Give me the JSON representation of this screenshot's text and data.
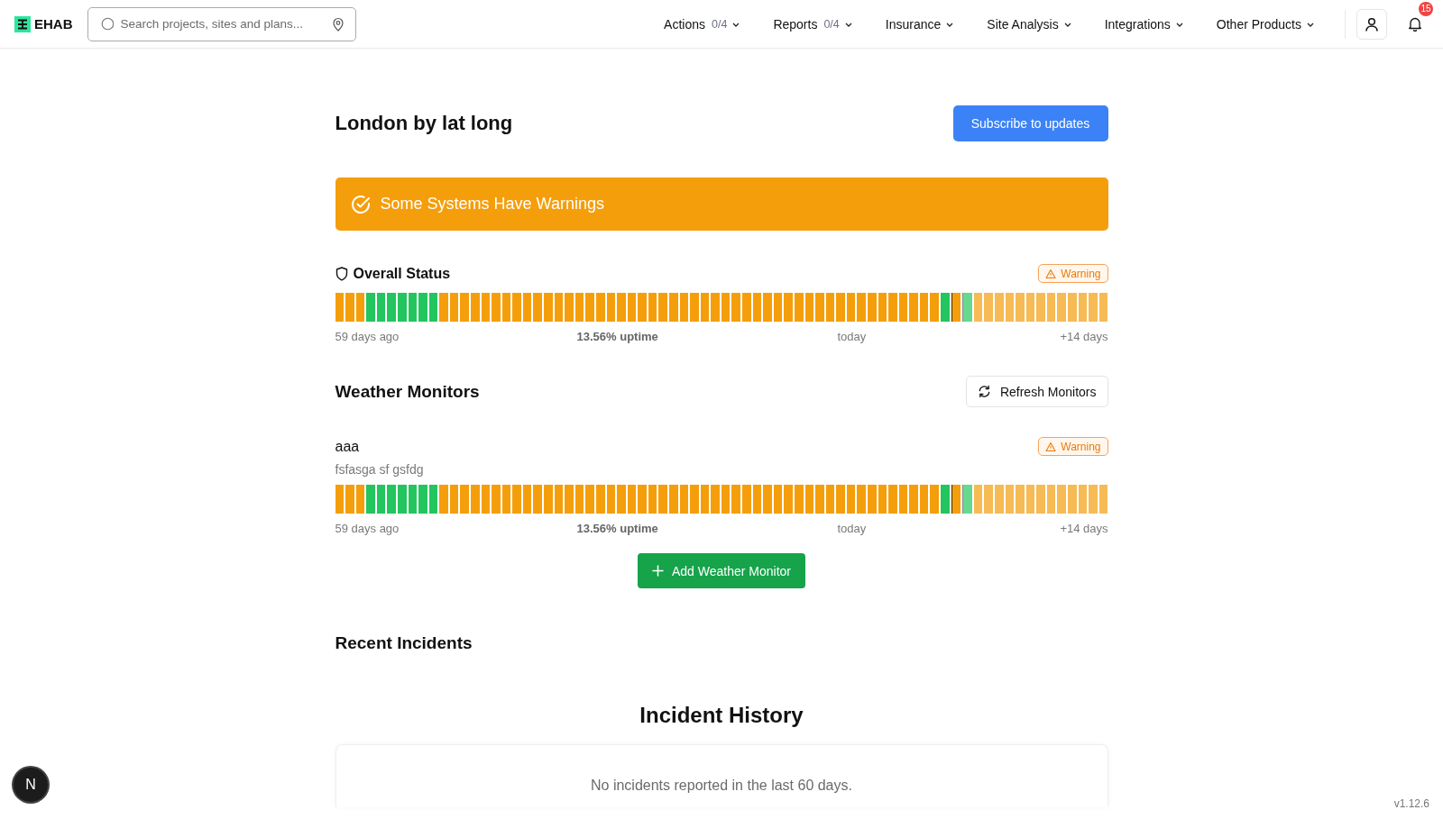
{
  "header": {
    "logo": "EHAB",
    "search": {
      "placeholder": "Search projects, sites and plans..."
    },
    "nav": [
      {
        "label": "Actions",
        "count": "0/4"
      },
      {
        "label": "Reports",
        "count": "0/4"
      },
      {
        "label": "Insurance"
      },
      {
        "label": "Site Analysis"
      },
      {
        "label": "Integrations"
      },
      {
        "label": "Other Products"
      }
    ],
    "notifications": {
      "badge": "15"
    }
  },
  "page": {
    "title": "London by lat long",
    "subscribe_button": "Subscribe to updates",
    "banner": {
      "kind": "warning",
      "text": "Some Systems Have Warnings"
    },
    "overall": {
      "title": "Overall Status",
      "badge": {
        "kind": "warning",
        "text": "Warning"
      },
      "bars": [
        {
          "kind": "warning"
        },
        {
          "kind": "warning"
        },
        {
          "kind": "warning"
        },
        {
          "kind": "operational"
        },
        {
          "kind": "operational"
        },
        {
          "kind": "operational"
        },
        {
          "kind": "operational"
        },
        {
          "kind": "operational"
        },
        {
          "kind": "operational"
        },
        {
          "kind": "operational"
        },
        {
          "kind": "warning"
        },
        {
          "kind": "warning"
        },
        {
          "kind": "warning"
        },
        {
          "kind": "warning"
        },
        {
          "kind": "warning"
        },
        {
          "kind": "warning"
        },
        {
          "kind": "warning"
        },
        {
          "kind": "warning"
        },
        {
          "kind": "warning"
        },
        {
          "kind": "warning"
        },
        {
          "kind": "warning"
        },
        {
          "kind": "warning"
        },
        {
          "kind": "warning"
        },
        {
          "kind": "warning"
        },
        {
          "kind": "warning"
        },
        {
          "kind": "warning"
        },
        {
          "kind": "warning"
        },
        {
          "kind": "warning"
        },
        {
          "kind": "warning"
        },
        {
          "kind": "warning"
        },
        {
          "kind": "warning"
        },
        {
          "kind": "warning"
        },
        {
          "kind": "warning"
        },
        {
          "kind": "warning"
        },
        {
          "kind": "warning"
        },
        {
          "kind": "warning"
        },
        {
          "kind": "warning"
        },
        {
          "kind": "warning"
        },
        {
          "kind": "warning"
        },
        {
          "kind": "warning"
        },
        {
          "kind": "warning"
        },
        {
          "kind": "warning"
        },
        {
          "kind": "warning"
        },
        {
          "kind": "warning"
        },
        {
          "kind": "warning"
        },
        {
          "kind": "warning"
        },
        {
          "kind": "warning"
        },
        {
          "kind": "warning"
        },
        {
          "kind": "warning"
        },
        {
          "kind": "warning"
        },
        {
          "kind": "warning"
        },
        {
          "kind": "warning"
        },
        {
          "kind": "warning"
        },
        {
          "kind": "warning"
        },
        {
          "kind": "warning"
        },
        {
          "kind": "warning"
        },
        {
          "kind": "warning"
        },
        {
          "kind": "warning"
        },
        {
          "kind": "operational"
        },
        {
          "kind": "today-warning"
        },
        {
          "kind": "forecast-operational"
        },
        {
          "kind": "forecast-warning"
        },
        {
          "kind": "forecast-warning"
        },
        {
          "kind": "forecast-warning"
        },
        {
          "kind": "forecast-warning"
        },
        {
          "kind": "forecast-warning"
        },
        {
          "kind": "forecast-warning"
        },
        {
          "kind": "forecast-warning"
        },
        {
          "kind": "forecast-warning"
        },
        {
          "kind": "forecast-warning"
        },
        {
          "kind": "forecast-warning"
        },
        {
          "kind": "forecast-warning"
        },
        {
          "kind": "forecast-warning"
        },
        {
          "kind": "forecast-warning"
        }
      ],
      "labels": {
        "start": "59 days ago",
        "uptime": "13.56% uptime",
        "today": "today",
        "end": "+14 days"
      }
    },
    "monitors_section": {
      "title": "Weather Monitors",
      "refresh_button": "Refresh Monitors",
      "monitors": [
        {
          "name": "aaa",
          "description": "fsfasga sf gsfdg",
          "badge": {
            "kind": "warning",
            "text": "Warning"
          },
          "bars": [
            {
              "kind": "warning"
            },
            {
              "kind": "warning"
            },
            {
              "kind": "warning"
            },
            {
              "kind": "operational"
            },
            {
              "kind": "operational"
            },
            {
              "kind": "operational"
            },
            {
              "kind": "operational"
            },
            {
              "kind": "operational"
            },
            {
              "kind": "operational"
            },
            {
              "kind": "operational"
            },
            {
              "kind": "warning"
            },
            {
              "kind": "warning"
            },
            {
              "kind": "warning"
            },
            {
              "kind": "warning"
            },
            {
              "kind": "warning"
            },
            {
              "kind": "warning"
            },
            {
              "kind": "warning"
            },
            {
              "kind": "warning"
            },
            {
              "kind": "warning"
            },
            {
              "kind": "warning"
            },
            {
              "kind": "warning"
            },
            {
              "kind": "warning"
            },
            {
              "kind": "warning"
            },
            {
              "kind": "warning"
            },
            {
              "kind": "warning"
            },
            {
              "kind": "warning"
            },
            {
              "kind": "warning"
            },
            {
              "kind": "warning"
            },
            {
              "kind": "warning"
            },
            {
              "kind": "warning"
            },
            {
              "kind": "warning"
            },
            {
              "kind": "warning"
            },
            {
              "kind": "warning"
            },
            {
              "kind": "warning"
            },
            {
              "kind": "warning"
            },
            {
              "kind": "warning"
            },
            {
              "kind": "warning"
            },
            {
              "kind": "warning"
            },
            {
              "kind": "warning"
            },
            {
              "kind": "warning"
            },
            {
              "kind": "warning"
            },
            {
              "kind": "warning"
            },
            {
              "kind": "warning"
            },
            {
              "kind": "warning"
            },
            {
              "kind": "warning"
            },
            {
              "kind": "warning"
            },
            {
              "kind": "warning"
            },
            {
              "kind": "warning"
            },
            {
              "kind": "warning"
            },
            {
              "kind": "warning"
            },
            {
              "kind": "warning"
            },
            {
              "kind": "warning"
            },
            {
              "kind": "warning"
            },
            {
              "kind": "warning"
            },
            {
              "kind": "warning"
            },
            {
              "kind": "warning"
            },
            {
              "kind": "warning"
            },
            {
              "kind": "warning"
            },
            {
              "kind": "operational"
            },
            {
              "kind": "today-warning"
            },
            {
              "kind": "forecast-operational"
            },
            {
              "kind": "forecast-warning"
            },
            {
              "kind": "forecast-warning"
            },
            {
              "kind": "forecast-warning"
            },
            {
              "kind": "forecast-warning"
            },
            {
              "kind": "forecast-warning"
            },
            {
              "kind": "forecast-warning"
            },
            {
              "kind": "forecast-warning"
            },
            {
              "kind": "forecast-warning"
            },
            {
              "kind": "forecast-warning"
            },
            {
              "kind": "forecast-warning"
            },
            {
              "kind": "forecast-warning"
            },
            {
              "kind": "forecast-warning"
            },
            {
              "kind": "forecast-warning"
            }
          ],
          "labels": {
            "start": "59 days ago",
            "uptime": "13.56% uptime",
            "today": "today",
            "end": "+14 days"
          }
        }
      ],
      "add_button": "Add Weather Monitor"
    },
    "incidents": {
      "title": "Recent Incidents",
      "history_title": "Incident History",
      "empty_message": "No incidents reported in the last 60 days."
    }
  },
  "dev_badge": "N",
  "version": "v1.12.6"
}
